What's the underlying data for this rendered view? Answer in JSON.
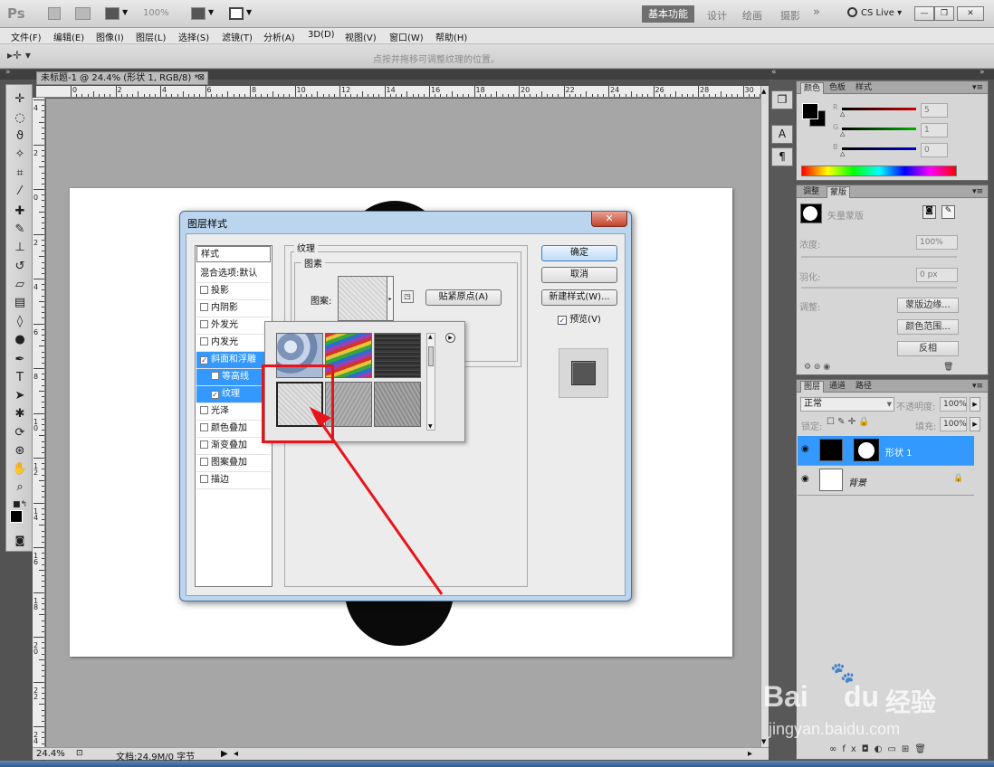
{
  "appbar": {
    "logo": "Ps",
    "zoom": "100%",
    "workspaces": [
      "基本功能",
      "设计",
      "绘画",
      "摄影",
      "»"
    ],
    "cslive": "CS Live",
    "window_buttons": [
      "—",
      "❐",
      "✕"
    ]
  },
  "menubar": {
    "items": [
      "文件(F)",
      "编辑(E)",
      "图像(I)",
      "图层(L)",
      "选择(S)",
      "滤镜(T)",
      "分析(A)",
      "3D(D)",
      "视图(V)",
      "窗口(W)",
      "帮助(H)"
    ]
  },
  "optbar": {
    "hint": "点按并拖移可调整纹理的位置。"
  },
  "document": {
    "tab_title": "未标题-1 @ 24.4% (形状 1, RGB/8) *",
    "ruler_top": [
      "0",
      "2",
      "4",
      "6",
      "8",
      "10",
      "12",
      "14",
      "16",
      "18",
      "20",
      "22",
      "24",
      "26",
      "28",
      "30"
    ],
    "ruler_left": [
      "4",
      "2",
      "0",
      "2",
      "4",
      "6",
      "8",
      "1 0",
      "1 2",
      "1 4",
      "1 6",
      "1 8",
      "2 0",
      "2 2",
      "2 4"
    ],
    "zoom": "24.4%",
    "doc_info": "文档:24.9M/0 字节"
  },
  "dock": {
    "icons": [
      "❐",
      "A",
      "¶"
    ]
  },
  "color_panel": {
    "tabs": [
      "颜色",
      "色板",
      "样式"
    ],
    "channels": [
      {
        "label": "R",
        "value": "5",
        "color": "#d40000"
      },
      {
        "label": "G",
        "value": "1",
        "color": "#00b000"
      },
      {
        "label": "B",
        "value": "0",
        "color": "#0000cc"
      }
    ]
  },
  "adjust_panel": {
    "tabs": [
      "调整",
      "蒙版"
    ],
    "title": "矢量蒙版",
    "density_label": "浓度:",
    "density_value": "100%",
    "feather_label": "羽化:",
    "feather_value": "0 px",
    "refine_label": "调整:",
    "buttons": [
      "蒙版边缘...",
      "颜色范围...",
      "反相"
    ]
  },
  "layers_panel": {
    "tabs": [
      "图层",
      "通道",
      "路径"
    ],
    "blend_mode": "正常",
    "opacity_label": "不透明度:",
    "opacity_value": "100%",
    "lock_label": "锁定:",
    "fill_label": "填充:",
    "fill_value": "100%",
    "layers": [
      {
        "name": "形状 1",
        "selected": true
      },
      {
        "name": "背景",
        "selected": false
      }
    ],
    "footer_icons": [
      "∞",
      "fx",
      "◘",
      "◐",
      "▭",
      "⊞",
      "🗑"
    ]
  },
  "dialog": {
    "title": "图层样式",
    "close": "✕",
    "style_list": {
      "header": "样式",
      "blend_default": "混合选项:默认",
      "items": [
        {
          "label": "投影",
          "checked": false,
          "sub": false,
          "selected": false
        },
        {
          "label": "内阴影",
          "checked": false,
          "sub": false,
          "selected": false
        },
        {
          "label": "外发光",
          "checked": false,
          "sub": false,
          "selected": false
        },
        {
          "label": "内发光",
          "checked": false,
          "sub": false,
          "selected": false
        },
        {
          "label": "斜面和浮雕",
          "checked": true,
          "sub": false,
          "selected": true
        },
        {
          "label": "等高线",
          "checked": false,
          "sub": true,
          "selected": true
        },
        {
          "label": "纹理",
          "checked": true,
          "sub": true,
          "selected": true
        },
        {
          "label": "光泽",
          "checked": false,
          "sub": false,
          "selected": false
        },
        {
          "label": "颜色叠加",
          "checked": false,
          "sub": false,
          "selected": false
        },
        {
          "label": "渐变叠加",
          "checked": false,
          "sub": false,
          "selected": false
        },
        {
          "label": "图案叠加",
          "checked": false,
          "sub": false,
          "selected": false
        },
        {
          "label": "描边",
          "checked": false,
          "sub": false,
          "selected": false
        }
      ]
    },
    "texture_group": "纹理",
    "pattern_group": "图素",
    "pattern_label": "图案:",
    "snap_button": "贴紧原点(A)",
    "ok": "确定",
    "cancel": "取消",
    "new_style": "新建样式(W)...",
    "preview_label": "预览(V)",
    "preview_checked": true
  },
  "watermark": {
    "brand": "Bai",
    "brand2": "du",
    "cn": "经验",
    "url": "jingyan.baidu.com"
  }
}
